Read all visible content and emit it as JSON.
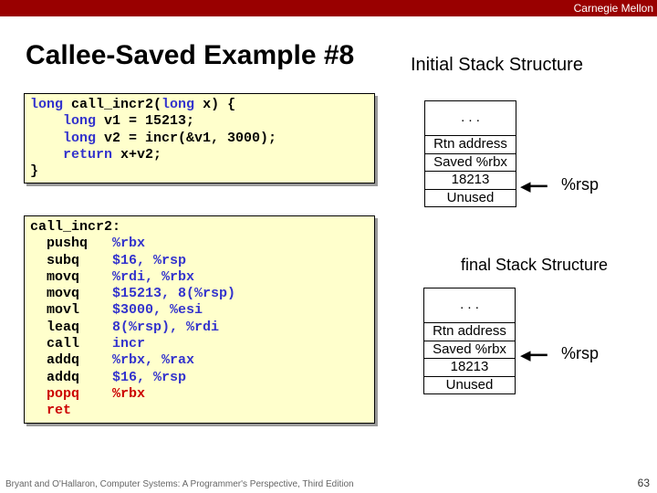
{
  "brand": "Carnegie Mellon",
  "title": "Callee-Saved Example #8",
  "subtitle": "Initial Stack Structure",
  "final_label": "final Stack Structure",
  "code_c": {
    "l1a": "long",
    "l1b": " call_incr2(",
    "l1c": "long",
    "l1d": " x) {",
    "l2a": "    long",
    "l2b": " v1 = 15213;",
    "l3a": "    long",
    "l3b": " v2 = incr(&v1, 3000);",
    "l4a": "    return",
    "l4b": " x+v2;",
    "l5": "}"
  },
  "code_asm": {
    "lbl": "call_incr2:",
    "i1a": "  pushq   ",
    "i1b": "%rbx",
    "i2a": "  subq    ",
    "i2b": "$16, %rsp",
    "i3a": "  movq    ",
    "i3b": "%rdi, %rbx",
    "i4a": "  movq    ",
    "i4b": "$15213, 8(%rsp)",
    "i5a": "  movl    ",
    "i5b": "$3000, %esi",
    "i6a": "  leaq    ",
    "i6b": "8(%rsp), %rdi",
    "i7a": "  call    ",
    "i7b": "incr",
    "i8a": "  addq    ",
    "i8b": "%rbx, %rax",
    "i9a": "  addq    ",
    "i9b": "$16, %rsp",
    "i10": "  popq    %rbx",
    "i11": "  ret"
  },
  "stack": {
    "dots": ". . .",
    "rtn": "Rtn address",
    "saved": "Saved %rbx",
    "v1": "18213",
    "unused": "Unused"
  },
  "rsp": "%rsp",
  "arrow": "◀━━",
  "footer": "Bryant and O'Hallaron, Computer Systems: A Programmer's Perspective, Third Edition",
  "pagenum": "63"
}
